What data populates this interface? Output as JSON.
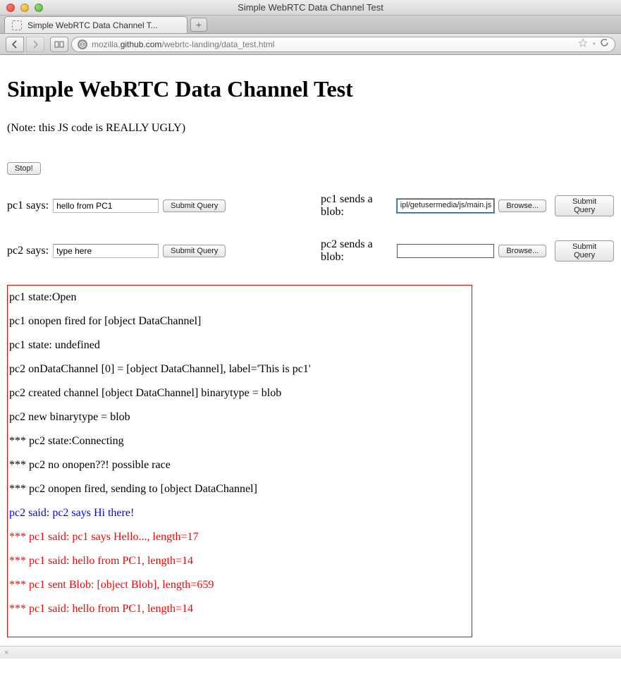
{
  "window": {
    "title": "Simple WebRTC Data Channel Test"
  },
  "tab": {
    "title": "Simple WebRTC Data Channel T..."
  },
  "url": {
    "prefix": "mozilla.",
    "domain": "github.com",
    "path": "/webrtc-landing/data_test.html"
  },
  "page": {
    "heading": "Simple WebRTC Data Channel Test",
    "note": "(Note: this JS code is REALLY UGLY)",
    "stop_label": "Stop!",
    "pc1_says_label": "pc1 says:",
    "pc1_says_value": "hello from PC1",
    "pc2_says_label": "pc2 says:",
    "pc2_says_value": "type here",
    "pc1_blob_label": "pc1 sends a blob:",
    "pc1_blob_file": "ipl/getusermedia/js/main.js",
    "pc2_blob_label": "pc2 sends a blob:",
    "pc2_blob_file": "",
    "browse_label": "Browse...",
    "submit_label": "Submit Query"
  },
  "log": [
    {
      "text": "pc1 state:Open",
      "cls": ""
    },
    {
      "text": "pc1 onopen fired for [object DataChannel]",
      "cls": ""
    },
    {
      "text": "pc1 state: undefined",
      "cls": ""
    },
    {
      "text": "pc2 onDataChannel [0] = [object DataChannel], label='This is pc1'",
      "cls": ""
    },
    {
      "text": "pc2 created channel [object DataChannel] binarytype = blob",
      "cls": ""
    },
    {
      "text": "pc2 new binarytype = blob",
      "cls": ""
    },
    {
      "text": "*** pc2 state:Connecting",
      "cls": ""
    },
    {
      "text": "*** pc2 no onopen??! possible race",
      "cls": ""
    },
    {
      "text": "*** pc2 onopen fired, sending to [object DataChannel]",
      "cls": ""
    },
    {
      "text": "pc2 said: pc2 says Hi there!",
      "cls": "log-blue"
    },
    {
      "text": "*** pc1 said: pc1 says Hello..., length=17",
      "cls": "log-red"
    },
    {
      "text": "*** pc1 said: hello from PC1, length=14",
      "cls": "log-red"
    },
    {
      "text": "*** pc1 sent Blob: [object Blob], length=659",
      "cls": "log-red"
    },
    {
      "text": "*** pc1 said: hello from PC1, length=14",
      "cls": "log-red"
    }
  ],
  "statusbar_close": "×"
}
